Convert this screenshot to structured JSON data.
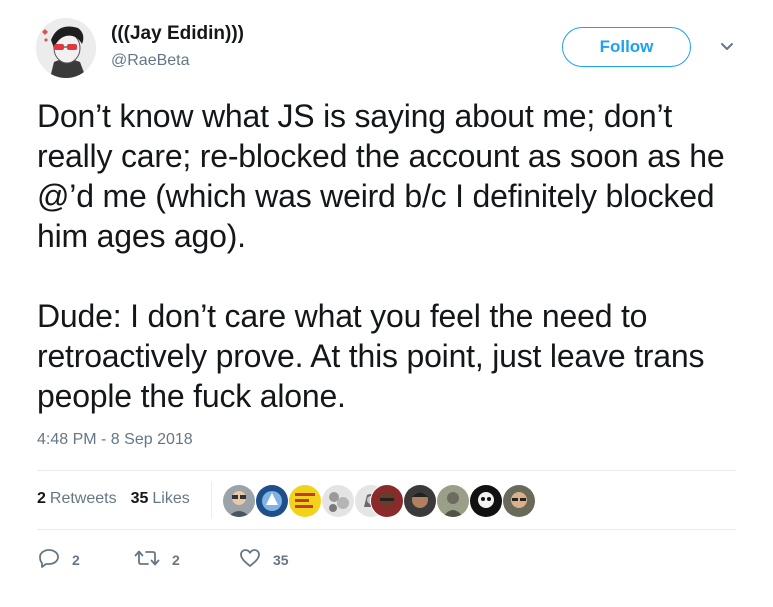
{
  "author": {
    "display_name": "(((Jay Edidin)))",
    "handle": "@RaeBeta"
  },
  "follow_button": {
    "label": "Follow"
  },
  "tweet": {
    "paragraphs": [
      "Don’t know what JS is saying about me; don’t really care; re-blocked the account as soon as he @’d me (which was weird b/c I definitely blocked him ages ago).",
      "Dude: I don’t care what you feel the need to retroactively prove. At this point, just leave trans people the fuck alone."
    ],
    "timestamp": "4:48 PM - 8 Sep 2018"
  },
  "stats": {
    "retweets_count": "2",
    "retweets_label": "Retweets",
    "likes_count": "35",
    "likes_label": "Likes"
  },
  "actions": {
    "reply_count": "2",
    "retweet_count": "2",
    "like_count": "35"
  },
  "icons": {
    "reply": "reply-icon",
    "retweet": "retweet-icon",
    "like": "heart-icon",
    "more": "chevron-down-icon"
  },
  "colors": {
    "accent": "#1da1f2",
    "secondary_text": "#657786",
    "primary_text": "#14171a"
  }
}
